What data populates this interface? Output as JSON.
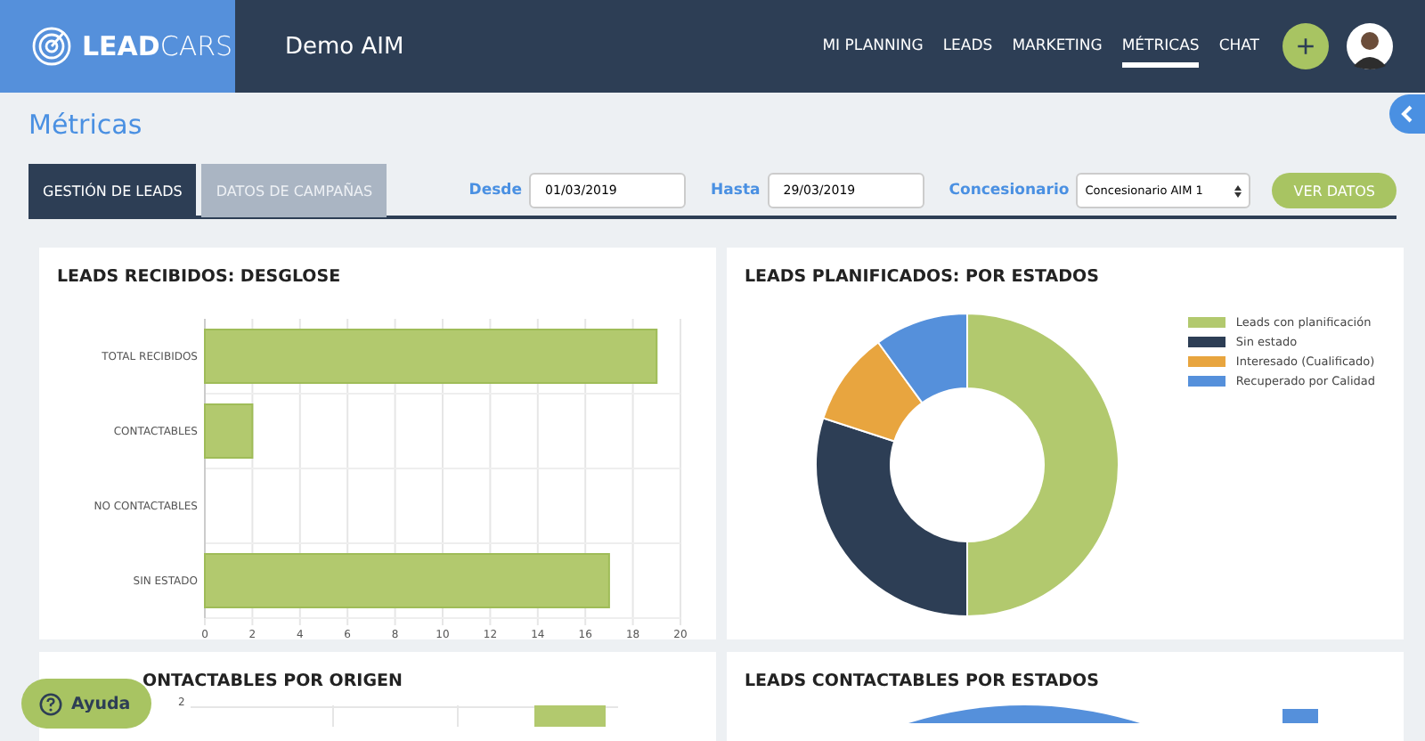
{
  "header": {
    "logo": {
      "bold": "LEAD",
      "light": "CARS"
    },
    "account": "Demo AIM",
    "nav": [
      {
        "label": "MI PLANNING",
        "selected": false
      },
      {
        "label": "LEADS",
        "selected": false
      },
      {
        "label": "MARKETING",
        "selected": false
      },
      {
        "label": "MÉTRICAS",
        "selected": true
      },
      {
        "label": "CHAT",
        "selected": false
      }
    ],
    "add_button": "+"
  },
  "page": {
    "title": "Métricas"
  },
  "tabs": [
    {
      "label": "GESTIÓN DE LEADS",
      "selected": true
    },
    {
      "label": "DATOS DE CAMPAÑAS",
      "selected": false
    }
  ],
  "filters": {
    "from": {
      "label": "Desde",
      "value": "01/03/2019"
    },
    "to": {
      "label": "Hasta",
      "value": "29/03/2019"
    },
    "dealer": {
      "label": "Concesionario",
      "value": "Concesionario AIM 1"
    },
    "submit": "VER DATOS"
  },
  "cards": [
    {
      "kind": "bar",
      "title": "LEADS RECIBIDOS: DESGLOSE",
      "chart_data": {
        "type": "bar",
        "orientation": "horizontal",
        "categories": [
          "TOTAL RECIBIDOS",
          "CONTACTABLES",
          "NO CONTACTABLES",
          "SIN ESTADO"
        ],
        "values": [
          19,
          2,
          0,
          17
        ],
        "xlim": [
          0,
          20
        ],
        "grid": true,
        "xticks": [
          0,
          2,
          4,
          6,
          8,
          10,
          12,
          14,
          16,
          18,
          20
        ]
      }
    },
    {
      "kind": "donut",
      "title": "LEADS PLANIFICADOS: POR ESTADOS",
      "legend": [
        {
          "label": "Leads con planificación",
          "color": "#b2c96e"
        },
        {
          "label": "Sin estado",
          "color": "#2d3e55"
        },
        {
          "label": "Interesado (Cualificado)",
          "color": "#e8a53f"
        },
        {
          "label": "Recuperado por Calidad",
          "color": "#5590db"
        }
      ]
    },
    {
      "kind": "bar-peek",
      "title": "ONTACTABLES POR ORIGEN",
      "tick": "2"
    },
    {
      "kind": "donut-peek",
      "title": "LEADS CONTACTABLES POR ESTADOS"
    }
  ],
  "help_button": "Ayuda"
}
